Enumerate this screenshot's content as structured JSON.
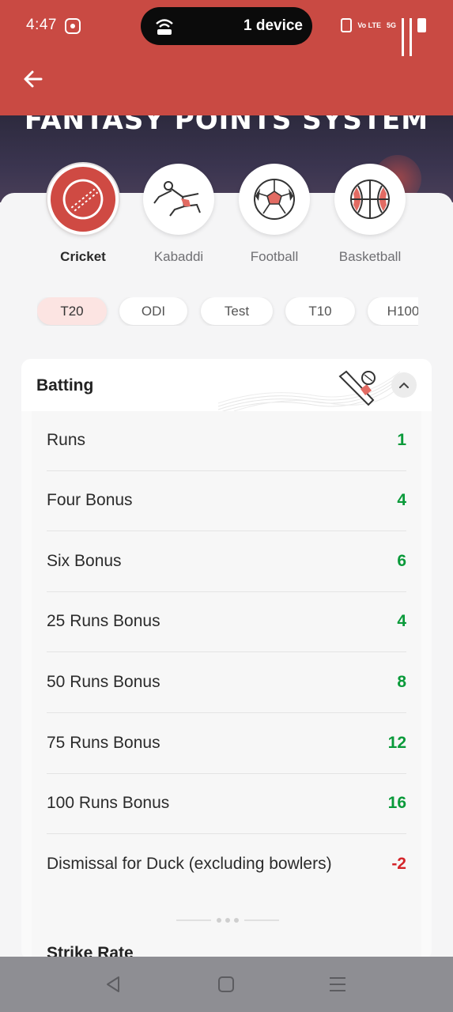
{
  "status_bar": {
    "time": "4:47",
    "island_text": "1 device",
    "volte": "Vo LTE",
    "net": "5G"
  },
  "banner": {
    "title": "FANTASY POINTS SYSTEM"
  },
  "sports": [
    {
      "label": "Cricket",
      "active": true,
      "icon": "cricket-ball-icon"
    },
    {
      "label": "Kabaddi",
      "active": false,
      "icon": "kabaddi-player-icon"
    },
    {
      "label": "Football",
      "active": false,
      "icon": "football-icon"
    },
    {
      "label": "Basketball",
      "active": false,
      "icon": "basketball-icon"
    }
  ],
  "formats": [
    {
      "label": "T20",
      "active": true
    },
    {
      "label": "ODI",
      "active": false
    },
    {
      "label": "Test",
      "active": false
    },
    {
      "label": "T10",
      "active": false
    },
    {
      "label": "H100",
      "active": false
    }
  ],
  "section": {
    "title": "Batting",
    "rows": [
      {
        "name": "Runs",
        "points": "1"
      },
      {
        "name": "Four Bonus",
        "points": "4"
      },
      {
        "name": "Six Bonus",
        "points": "6"
      },
      {
        "name": "25 Runs Bonus",
        "points": "4"
      },
      {
        "name": "50 Runs Bonus",
        "points": "8"
      },
      {
        "name": "75 Runs Bonus",
        "points": "12"
      },
      {
        "name": "100 Runs Bonus",
        "points": "16"
      },
      {
        "name": "Dismissal for Duck (excluding bowlers)",
        "points": "-2"
      }
    ],
    "next_title": "Strike Rate"
  },
  "colors": {
    "brand": "#c94a43",
    "positive": "#0a9a3a",
    "negative": "#d4252a"
  }
}
